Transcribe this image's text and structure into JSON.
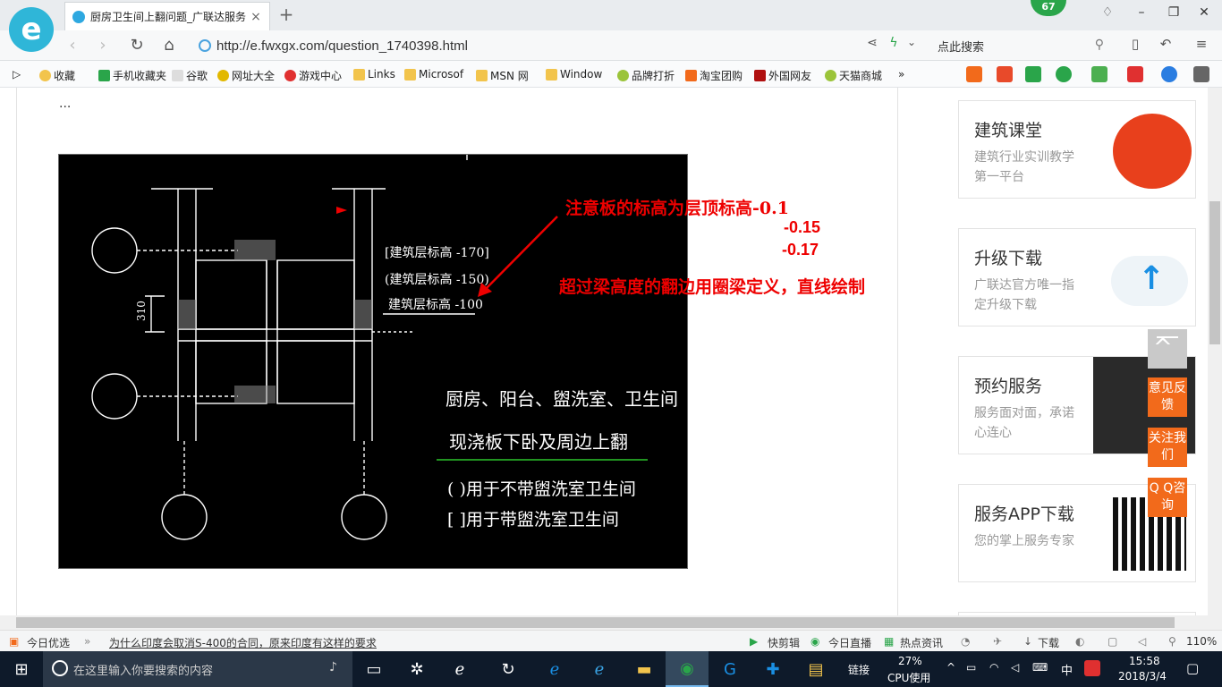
{
  "browser": {
    "tab_title": "厨房卫生间上翻问题_广联达服务",
    "tab_close": "×",
    "new_tab": "+",
    "notification_count": "67",
    "url": "http://e.fwxgx.com/question_1740398.html",
    "search_placeholder": "点此搜索",
    "zoom": "110%"
  },
  "bookmarks": [
    {
      "label": "收藏",
      "icon": "star-icon"
    },
    {
      "label": "手机收藏夹",
      "icon": "phone-icon"
    },
    {
      "label": "谷歌",
      "icon": "page-icon"
    },
    {
      "label": "网址大全",
      "icon": "globe-icon"
    },
    {
      "label": "游戏中心",
      "icon": "game-icon"
    },
    {
      "label": "Links",
      "icon": "folder-icon"
    },
    {
      "label": "Microsof",
      "icon": "folder-icon"
    },
    {
      "label": "MSN 网",
      "icon": "folder-icon"
    },
    {
      "label": "Window",
      "icon": "folder-icon"
    },
    {
      "label": "品牌打折",
      "icon": "leaf-icon"
    },
    {
      "label": "淘宝团购",
      "icon": "taobao-icon"
    },
    {
      "label": "外国网友",
      "icon": "bookmark-icon"
    },
    {
      "label": "天猫商城",
      "icon": "leaf-icon"
    }
  ],
  "bookmarks_more": "»",
  "article": {
    "ellipsis": "...",
    "annotation_line1": "注意板的标高为层顶标高-0.1",
    "annotation_num2": "-0.15",
    "annotation_num3": "-0.17",
    "annotation_line4": "超过梁高度的翻边用圈梁定义，直线绘制",
    "cad": {
      "elev1": "[建筑层标高 -170]",
      "elev2": "(建筑层标高 -150)",
      "elev3": "建筑层标高 -100",
      "dim": "310",
      "note_line1": "厨房、阳台、盥洗室、卫生间",
      "note_line2": "现浇板下卧及周边上翻",
      "legend1": "( )用于不带盥洗室卫生间",
      "legend2": "[   ]用于带盥洗室卫生间"
    }
  },
  "sidebar": [
    {
      "title": "建筑课堂",
      "desc": "建筑行业实训教学第一平台",
      "icon": "guanglianda-logo-icon"
    },
    {
      "title": "升级下载",
      "desc": "广联达官方唯一指定升级下载",
      "icon": "cloud-upload-icon"
    },
    {
      "title": "预约服务",
      "desc": "服务面对面，承诺心连心",
      "icon": "handshake-photo-icon"
    },
    {
      "title": "服务APP下载",
      "desc": "您的掌上服务专家",
      "icon": "qr-code-icon"
    }
  ],
  "float_buttons": [
    "意见反馈",
    "关注我们",
    "Q Q咨询"
  ],
  "statusbar": {
    "today_pick": "今日优选",
    "news": "为什么印度会取消S-400的合同，原来印度有这样的要求",
    "clip": "快剪辑",
    "live": "今日直播",
    "hot": "热点资讯",
    "download": "下载",
    "zoom": "110%"
  },
  "taskbar": {
    "search_placeholder": "在这里输入你要搜索的内容",
    "links": "链接",
    "cpu_percent": "27%",
    "cpu_label": "CPU使用",
    "ime": "中",
    "time": "15:58",
    "date": "2018/3/4"
  },
  "colors": {
    "accent_orange": "#f26a1b",
    "annotation_red": "#e00000",
    "taskbar_bg": "#0e1a2a"
  }
}
